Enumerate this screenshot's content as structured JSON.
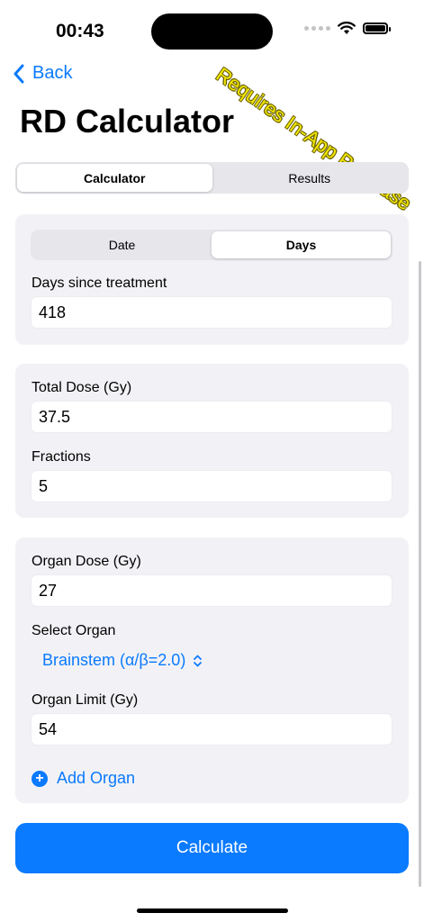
{
  "status_bar": {
    "time": "00:43"
  },
  "watermark": "Requires In-App Purchase",
  "nav": {
    "back_label": "Back",
    "title": "RD Calculator"
  },
  "main_tabs": [
    {
      "label": "Calculator",
      "selected": true
    },
    {
      "label": "Results",
      "selected": false
    }
  ],
  "treatment": {
    "mode_tabs": [
      {
        "label": "Date",
        "selected": false
      },
      {
        "label": "Days",
        "selected": true
      }
    ],
    "days_label": "Days since treatment",
    "days_value": "418"
  },
  "dose": {
    "total_dose_label": "Total Dose (Gy)",
    "total_dose_value": "37.5",
    "fractions_label": "Fractions",
    "fractions_value": "5"
  },
  "organ": {
    "organ_dose_label": "Organ Dose (Gy)",
    "organ_dose_value": "27",
    "select_organ_label": "Select Organ",
    "selected_organ": "Brainstem (α/β=2.0)",
    "organ_limit_label": "Organ Limit (Gy)",
    "organ_limit_value": "54",
    "add_organ_label": "Add Organ"
  },
  "calculate_label": "Calculate",
  "colors": {
    "accent": "#0a7aff",
    "card_bg": "#f2f2f6",
    "watermark": "#f2e600"
  }
}
